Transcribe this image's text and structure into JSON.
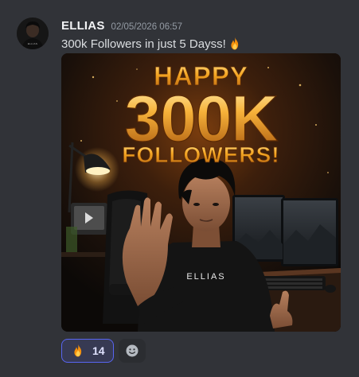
{
  "message": {
    "author": "ELLIAS",
    "timestamp": "02/05/2026 06:57",
    "text": "300k Followers in just 5 Dayss!",
    "text_emoji_icon": "fire-emoji"
  },
  "attachment": {
    "headline_top": "HAPPY",
    "headline_number": "300K",
    "headline_bottom": "FOLLOWERS!",
    "shirt_text": "ELLIAS",
    "avatar_shirt_text": "ELLIAS"
  },
  "reactions": [
    {
      "emoji_icon": "fire-emoji",
      "count": "14",
      "selected": true
    }
  ],
  "add_reaction_icon": "smiley-add-icon",
  "colors": {
    "background": "#313338",
    "username": "#f2f3f5",
    "timestamp": "#949ba4",
    "reaction_selected_border": "#5865f2",
    "reaction_selected_bg": "#373a53"
  }
}
